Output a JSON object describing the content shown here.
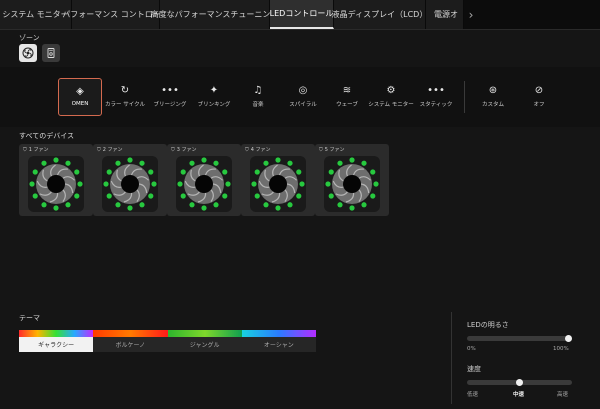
{
  "tabs": [
    {
      "label": "システム モニター",
      "active": false
    },
    {
      "label": "パフォーマンス コントロール",
      "active": false
    },
    {
      "label": "高度なパフォーマンスチューニング",
      "active": false
    },
    {
      "label": "LEDコントロール",
      "active": true
    },
    {
      "label": "液晶ディスプレイ（LCD）",
      "active": false
    },
    {
      "label": "電源オ",
      "active": false
    }
  ],
  "zone": {
    "label": "ゾーン"
  },
  "effects": [
    {
      "label": "OMEN",
      "icon": "omen-diamond-icon",
      "selected": true
    },
    {
      "label": "カラー サイクル",
      "icon": "color-cycle-icon",
      "selected": false
    },
    {
      "label": "ブリージング",
      "icon": "breathing-icon",
      "selected": false
    },
    {
      "label": "ブリンキング",
      "icon": "blinking-icon",
      "selected": false
    },
    {
      "label": "音楽",
      "icon": "music-icon",
      "selected": false
    },
    {
      "label": "スパイラル",
      "icon": "spiral-icon",
      "selected": false
    },
    {
      "label": "ウェーブ",
      "icon": "wave-icon",
      "selected": false
    },
    {
      "label": "システム モニター",
      "icon": "system-monitor-icon",
      "selected": false
    },
    {
      "label": "スタティック",
      "icon": "static-icon",
      "selected": false
    },
    {
      "label": "カスタム",
      "icon": "custom-icon",
      "selected": false
    },
    {
      "label": "オフ",
      "icon": "off-icon",
      "selected": false
    }
  ],
  "devices_title": "すべてのデバイス",
  "devices": [
    {
      "label": "1 ファン"
    },
    {
      "label": "2 ファン"
    },
    {
      "label": "3 ファン"
    },
    {
      "label": "4 ファン"
    },
    {
      "label": "5 ファン"
    }
  ],
  "led_color": "#27c93f",
  "accent_color": "#d46a4f",
  "theme": {
    "label": "テーマ",
    "items": [
      {
        "name": "ギャラクシー",
        "selected": true,
        "colors": [
          "#ff2a2a",
          "#ffb400",
          "#35e035",
          "#27a8ff",
          "#c02cff"
        ]
      },
      {
        "name": "ボルケーノ",
        "selected": false,
        "colors": [
          "#ff3a00",
          "#ff7a00",
          "#ff1a1a"
        ]
      },
      {
        "name": "ジャングル",
        "selected": false,
        "colors": [
          "#2db52d",
          "#7fd82b",
          "#10a050"
        ]
      },
      {
        "name": "オーシャン",
        "selected": false,
        "colors": [
          "#18d2e0",
          "#2a7bff",
          "#b42cff"
        ]
      }
    ]
  },
  "brightness": {
    "label": "LEDの明るさ",
    "value_percent": 100,
    "min_label": "0%",
    "max_label": "100%"
  },
  "speed": {
    "label": "速度",
    "options": [
      "低速",
      "中速",
      "高速"
    ],
    "selected": "中速"
  }
}
